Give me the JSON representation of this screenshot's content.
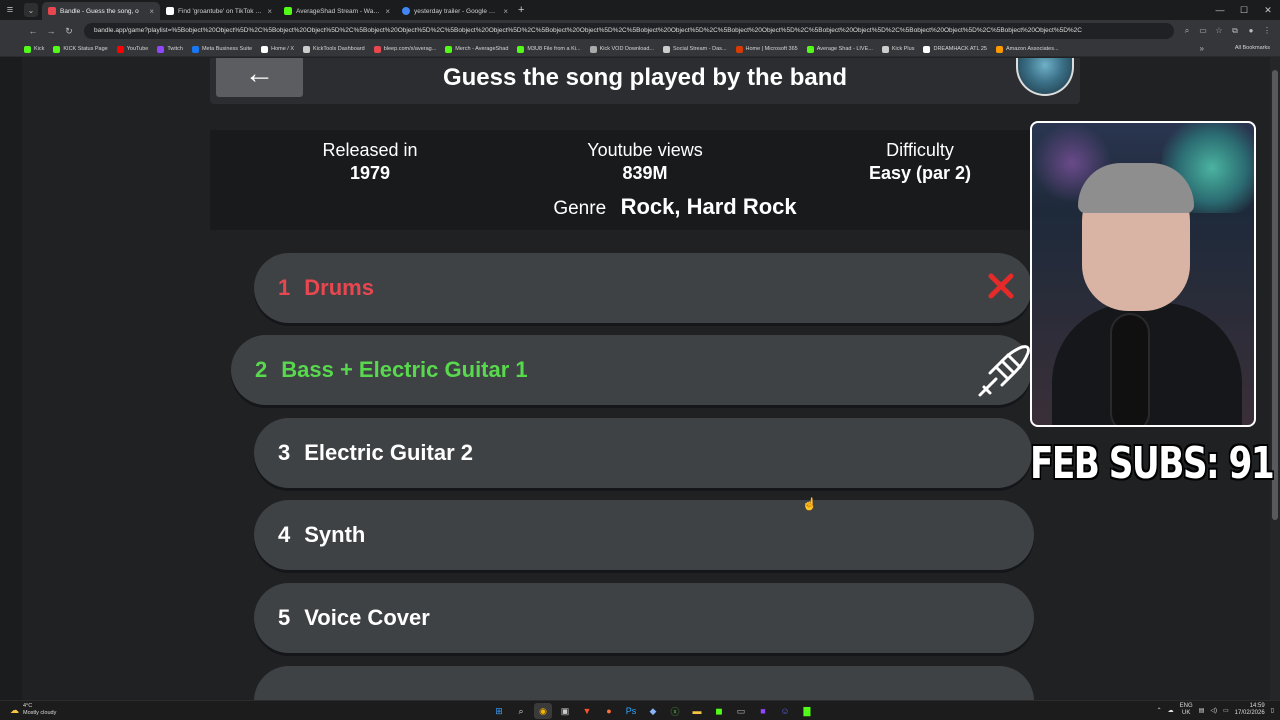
{
  "browser": {
    "tabs": [
      {
        "title": "Bandle - Guess the song, o",
        "color": "#e8474f",
        "active": true
      },
      {
        "title": "Find 'groantube' on TikTok | Tik",
        "color": "#ffffff",
        "active": false
      },
      {
        "title": "AverageShad Stream - Watch L",
        "color": "#53fc18",
        "active": false
      },
      {
        "title": "yesterday trailer - Google Sear",
        "color": "#4285f4",
        "active": false
      }
    ],
    "url": "bandle.app/game?playlist=%5Bobject%20Object%5D%2C%5Bobject%20Object%5D%2C%5Bobject%20Object%5D%2C%5Bobject%20Object%5D%2C%5Bobject%20Object%5D%2C%5Bobject%20Object%5D%2C%5Bobject%20Object%5D%2C%5Bobject%20Object%5D%2C%5Bobject%20Object%5D%2C%5Bobject%20Object%5D%2C",
    "bookmarks": [
      {
        "label": "Kick",
        "color": "#53fc18"
      },
      {
        "label": "KICK Status Page",
        "color": "#53fc18"
      },
      {
        "label": "YouTube",
        "color": "#ff0000"
      },
      {
        "label": "Twitch",
        "color": "#9146ff"
      },
      {
        "label": "Meta Business Suite",
        "color": "#1877f2"
      },
      {
        "label": "Home / X",
        "color": "#ffffff"
      },
      {
        "label": "KickTools Dashboard",
        "color": "#cccccc"
      },
      {
        "label": "bleep.com/x/averag...",
        "color": "#e8474f"
      },
      {
        "label": "Merch - AverageShad",
        "color": "#53fc18"
      },
      {
        "label": "M3U8 File from a Ki...",
        "color": "#53fc18"
      },
      {
        "label": "Kick VOD Download...",
        "color": "#aaaaaa"
      },
      {
        "label": "Social Stream - Das...",
        "color": "#cccccc"
      },
      {
        "label": "Home | Microsoft 365",
        "color": "#d83b01"
      },
      {
        "label": "Average Shad - LIVE...",
        "color": "#53fc18"
      },
      {
        "label": "Kick Plus",
        "color": "#cccccc"
      },
      {
        "label": "DREAMHACK ATL 25",
        "color": "#ffffff"
      },
      {
        "label": "Amazon Associates...",
        "color": "#ff9900"
      }
    ],
    "all_bookmarks_label": "All Bookmarks"
  },
  "game": {
    "back_icon": "←",
    "title": "Guess the song played by the band",
    "info": {
      "released_label": "Released in",
      "released_value": "1979",
      "views_label": "Youtube views",
      "views_value": "839M",
      "difficulty_label": "Difficulty",
      "difficulty_value": "Easy (par 2)",
      "genre_label": "Genre",
      "genre_value": "Rock, Hard Rock"
    },
    "tracks": [
      {
        "num": "1",
        "label": "Drums",
        "state": "wrong"
      },
      {
        "num": "2",
        "label": "Bass + Electric Guitar 1",
        "state": "current"
      },
      {
        "num": "3",
        "label": "Electric Guitar 2",
        "state": "locked"
      },
      {
        "num": "4",
        "label": "Synth",
        "state": "locked"
      },
      {
        "num": "5",
        "label": "Voice Cover",
        "state": "locked"
      }
    ],
    "colors": {
      "wrong": "#e8474f",
      "current": "#58d84d"
    }
  },
  "overlay": {
    "subs_text": "FEB SUBS: 91"
  },
  "taskbar": {
    "weather_temp": "4°C",
    "weather_text": "Mostly cloudy",
    "lang_top": "ENG",
    "lang_bottom": "UK",
    "time": "14:59",
    "date": "17/02/2026"
  }
}
